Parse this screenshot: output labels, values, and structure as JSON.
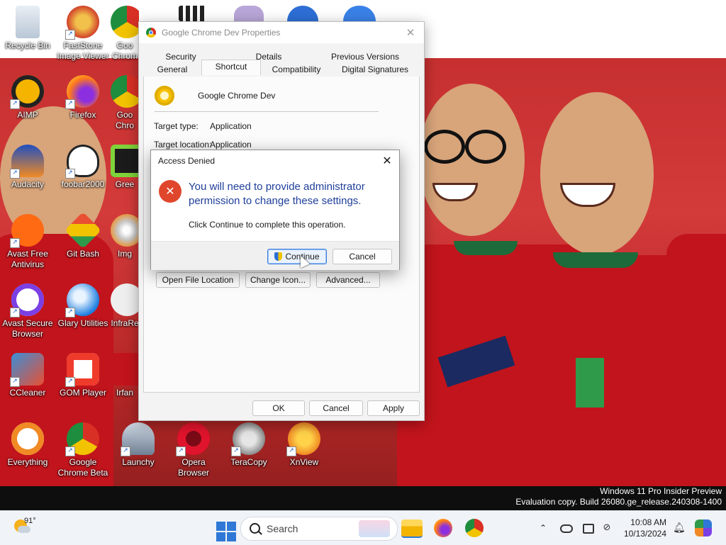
{
  "desktop": {
    "icons": [
      {
        "label": "Recycle Bin"
      },
      {
        "label": "FastStone Image Viewer"
      },
      {
        "label": "Goo Chrom"
      },
      {
        "label": "AIMP"
      },
      {
        "label": "Firefox"
      },
      {
        "label": "Goo Chro"
      },
      {
        "label": "Audacity"
      },
      {
        "label": "foobar2000"
      },
      {
        "label": "Gree"
      },
      {
        "label": "Avast Free Antivirus"
      },
      {
        "label": "Git Bash"
      },
      {
        "label": "Img"
      },
      {
        "label": "Avast Secure Browser"
      },
      {
        "label": "Glary Utilities"
      },
      {
        "label": "InfraRe"
      },
      {
        "label": "CCleaner"
      },
      {
        "label": "GOM Player"
      },
      {
        "label": "Irfan"
      },
      {
        "label": "Everything"
      },
      {
        "label": "Google Chrome Beta"
      },
      {
        "label": "Launchy"
      },
      {
        "label": "Opera Browser"
      },
      {
        "label": "TeraCopy"
      },
      {
        "label": "XnView"
      }
    ]
  },
  "properties": {
    "title": "Google Chrome Dev Properties",
    "tabs_row1": [
      "Security",
      "Details",
      "Previous Versions"
    ],
    "tabs_row2": [
      "General",
      "Shortcut",
      "Compatibility",
      "Digital Signatures"
    ],
    "active_tab": "Shortcut",
    "app_name": "Google Chrome Dev",
    "target_type_label": "Target type:",
    "target_type_value": "Application",
    "target_location_label": "Target location:",
    "target_location_value": "Application",
    "open_file_location": "Open File Location",
    "change_icon": "Change Icon...",
    "advanced": "Advanced...",
    "ok": "OK",
    "cancel": "Cancel",
    "apply": "Apply"
  },
  "access_denied": {
    "title": "Access Denied",
    "close": "✕",
    "message": "You will need to provide administrator permission to change these settings.",
    "sub": "Click Continue to complete this operation.",
    "continue": "Continue",
    "cancel": "Cancel"
  },
  "watermark": {
    "line1": "Windows 11 Pro Insider Preview",
    "line2": "Evaluation copy. Build 26080.ge_release.240308-1400"
  },
  "taskbar": {
    "temperature": "91°",
    "search_placeholder": "Search",
    "time": "10:08 AM",
    "date": "10/13/2024"
  },
  "colors": {
    "wallpaper_red": "#c73030",
    "dialog_message_blue": "#1f3f9a",
    "error_red": "#e0462c",
    "default_button_blue": "#3b7de0"
  }
}
